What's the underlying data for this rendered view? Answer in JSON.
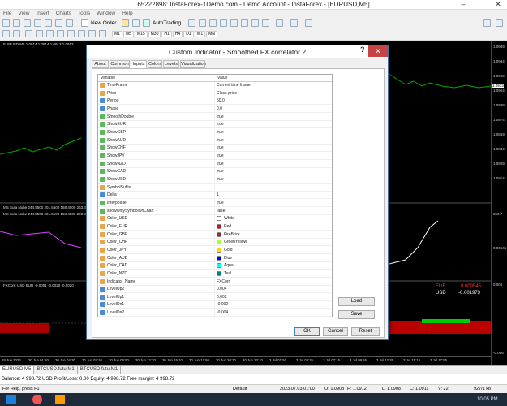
{
  "window": {
    "title": "65222898: InstaForex-1Demo.com - Demo Account - InstaForex - [EURUSD,M5]"
  },
  "menu": [
    "File",
    "View",
    "Insert",
    "Charts",
    "Tools",
    "Window",
    "Help"
  ],
  "toolbar": {
    "new_order": "New Order",
    "autotrading": "AutoTrading",
    "timeframes": [
      "M1",
      "M5",
      "M15",
      "M30",
      "H1",
      "H4",
      "D1",
      "W1",
      "MN"
    ]
  },
  "chart": {
    "info": "EURUSD,M5  1.0914 1.0914 1.0913 1.0913",
    "sub_labels": [
      "MS Suta Nube 244.5500 201.5500 158.4500 263.3500",
      "MS Suta Nube 244.5500 201.5500 158.4500 263.3500"
    ],
    "fxcorr_label": "FXCorr: USD EUR -0.0001 -0.0020 -0.0020",
    "eur_label": "EUR",
    "eur_value": "0.000545",
    "usd_label": "USD",
    "usd_value": "-0.001973",
    "price_scale": [
      "1.0949",
      "1.0934",
      "1.0919",
      "1.0904",
      "1.0889",
      "1.0874",
      "1.0859",
      "1.0844",
      "1.0829",
      "1.0814"
    ],
    "current_price": "1.0913",
    "sub_scale": [
      "350.7",
      "0.00545",
      "0.006",
      "-0.006"
    ],
    "time_axis": [
      "29 Jun 2023",
      "30 Jun 01:50",
      "30 Jun 04:30",
      "30 Jun 07:10",
      "30 Jun 09:50",
      "30 Jun 12:30",
      "30 Jun 15:10",
      "30 Jun 17:50",
      "30 Jun 20:30",
      "30 Jun 23:10",
      "3 Jul 01:50",
      "3 Jul 04:35",
      "3 Jul 07:15",
      "3 Jul 09:55",
      "3 Jul 12:35",
      "3 Jul 15:15",
      "3 Jul 17:55"
    ]
  },
  "chart_tabs": [
    "EURUSD,M5",
    "BTCUSD.futu,M1",
    "BTCUSD.futu,M1"
  ],
  "terminal": {
    "summary": "Balance: 4 998.72 USD  Profit/Loss: 0.00  Equity: 4 998.72  Free margin: 4 998.72"
  },
  "status": {
    "help": "For Help, press F1",
    "profile": "Default",
    "time": "2023.07.03 01:00",
    "open": "O: 1.0908",
    "high": "H: 1.0912",
    "low": "L: 1.0908",
    "close": "C: 1.0911",
    "volume": "V: 22",
    "traffic": "927/1 kb"
  },
  "taskbar": {
    "clock": "10:05 PM"
  },
  "dialog": {
    "title": "Custom Indicator - Smoothed FX correlator 2",
    "help_symbol": "?",
    "close_symbol": "✕",
    "tabs": [
      "About",
      "Common",
      "Inputs",
      "Colors",
      "Levels",
      "Visualization"
    ],
    "selected_tab": "Inputs",
    "col_variable": "Variable",
    "col_value": "Value",
    "rows": [
      {
        "name": "TimeFrame",
        "value": "Current time frame",
        "icon": "ab"
      },
      {
        "name": "Price",
        "value": "Close price",
        "icon": "ab"
      },
      {
        "name": "Period",
        "value": "50.0",
        "icon": "num"
      },
      {
        "name": "Phase",
        "value": "0.0",
        "icon": "num"
      },
      {
        "name": "SmoothDouble",
        "value": "true",
        "icon": "bool"
      },
      {
        "name": "ShowEUR",
        "value": "true",
        "icon": "bool"
      },
      {
        "name": "ShowGBP",
        "value": "true",
        "icon": "bool"
      },
      {
        "name": "ShowAUD",
        "value": "true",
        "icon": "bool"
      },
      {
        "name": "ShowCHF",
        "value": "true",
        "icon": "bool"
      },
      {
        "name": "ShowJPY",
        "value": "true",
        "icon": "bool"
      },
      {
        "name": "ShowNZD",
        "value": "true",
        "icon": "bool"
      },
      {
        "name": "ShowCAD",
        "value": "true",
        "icon": "bool"
      },
      {
        "name": "ShowUSD",
        "value": "true",
        "icon": "bool"
      },
      {
        "name": "SymbolSuffix",
        "value": "",
        "icon": "ab"
      },
      {
        "name": "Delta",
        "value": "1",
        "icon": "num"
      },
      {
        "name": "Interpolate",
        "value": "true",
        "icon": "bool"
      },
      {
        "name": "showOnlySymbolOnChart",
        "value": "false",
        "icon": "bool"
      },
      {
        "name": "Color_USD",
        "value": "White",
        "icon": "color",
        "swatch": "#ffffff"
      },
      {
        "name": "Color_EUR",
        "value": "Red",
        "icon": "color",
        "swatch": "#ff0000"
      },
      {
        "name": "Color_GBP",
        "value": "FireBrick",
        "icon": "color",
        "swatch": "#b22222"
      },
      {
        "name": "Color_CHF",
        "value": "GreenYellow",
        "icon": "color",
        "swatch": "#adff2f"
      },
      {
        "name": "Color_JPY",
        "value": "Gold",
        "icon": "color",
        "swatch": "#ffd700"
      },
      {
        "name": "Color_AUD",
        "value": "Blue",
        "icon": "color",
        "swatch": "#0000ff"
      },
      {
        "name": "Color_CAD",
        "value": "Aqua",
        "icon": "color",
        "swatch": "#00ffff"
      },
      {
        "name": "Color_NZD",
        "value": "Teal",
        "icon": "color",
        "swatch": "#008080"
      },
      {
        "name": "Indicator_Name",
        "value": "FXCorr",
        "icon": "ab"
      },
      {
        "name": "LevelUp2",
        "value": "0.004",
        "icon": "num"
      },
      {
        "name": "LevelUp1",
        "value": "0.002",
        "icon": "num"
      },
      {
        "name": "LevelDn1",
        "value": "-0.002",
        "icon": "num"
      },
      {
        "name": "LevelDn2",
        "value": "-0.004",
        "icon": "num"
      }
    ],
    "load_label": "Load",
    "save_label": "Save",
    "ok_label": "OK",
    "cancel_label": "Cancel",
    "reset_label": "Reset"
  }
}
